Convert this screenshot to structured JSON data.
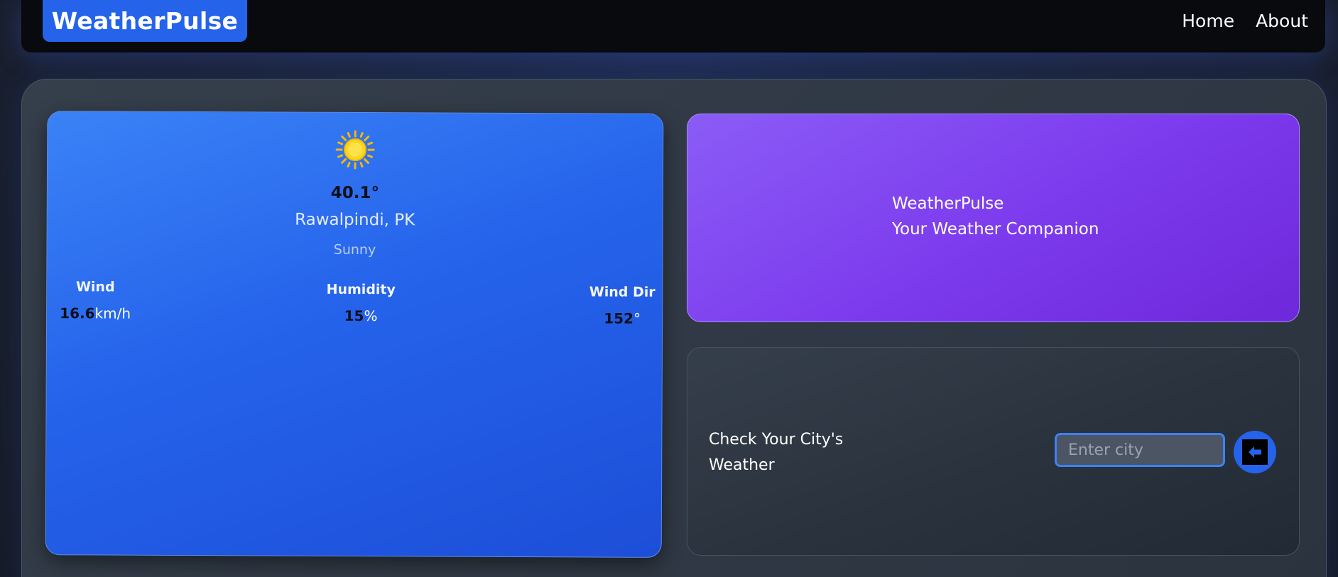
{
  "navbar": {
    "brand": "WeatherPulse",
    "links": [
      "Home",
      "About"
    ]
  },
  "weather": {
    "icon": "sun-icon",
    "temperature": "40.1°",
    "location": "Rawalpindi, PK",
    "condition": "Sunny",
    "stats": {
      "wind": {
        "label": "Wind",
        "value": "16.6",
        "unit": "km/h"
      },
      "humidity": {
        "label": "Humidity",
        "value": "15",
        "unit": "%"
      },
      "wind_dir": {
        "label": "Wind Dir",
        "value": "152",
        "unit": "°"
      }
    }
  },
  "hero": {
    "title": "WeatherPulse",
    "subtitle": "Your Weather Companion"
  },
  "search": {
    "heading": "Check Your City's Weather",
    "placeholder": "Enter city",
    "button_icon": "arrow-left-icon"
  },
  "colors": {
    "brand": "#2563eb",
    "weather_card": "#2563eb",
    "hero_card": "#7c3aed",
    "input_border": "#3b82f6"
  }
}
